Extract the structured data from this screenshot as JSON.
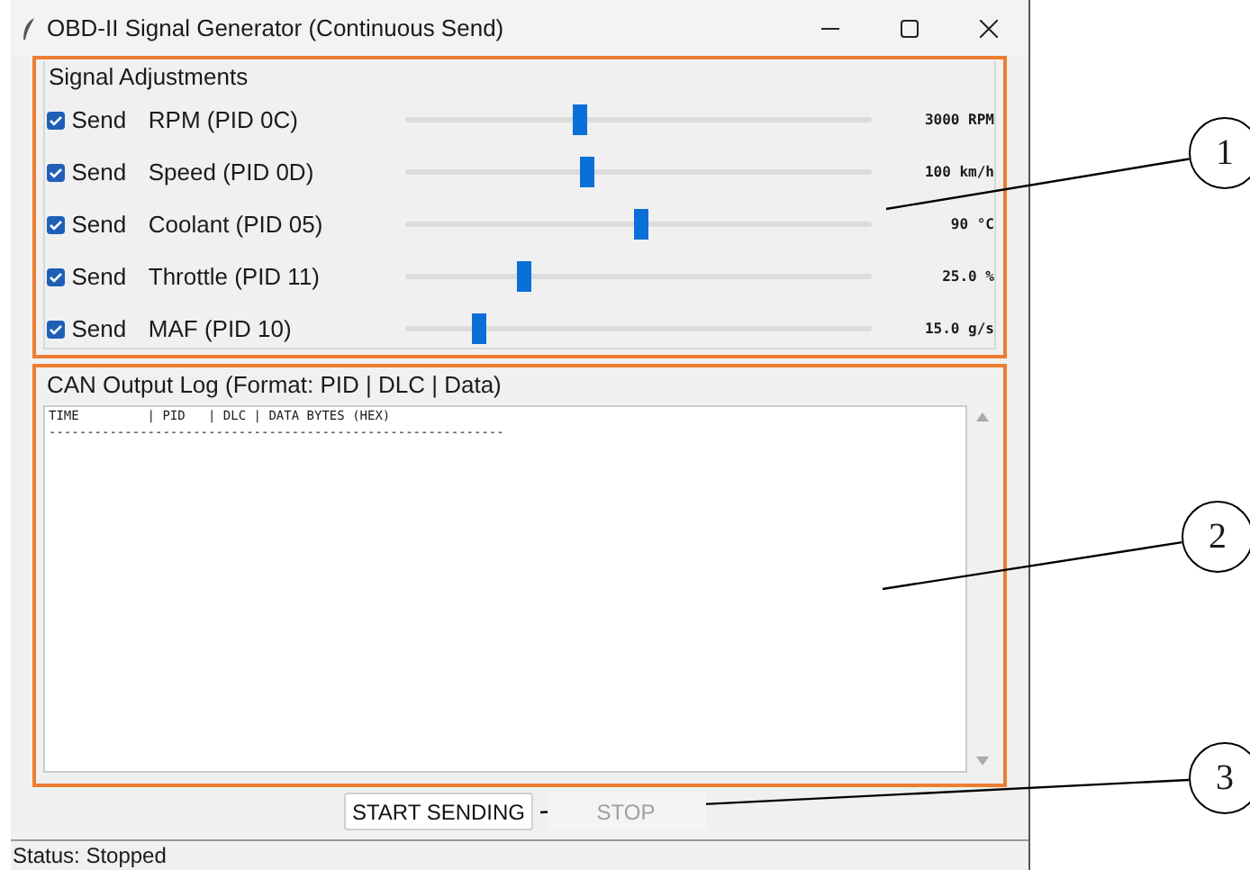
{
  "window": {
    "title": "OBD-II Signal Generator (Continuous Send)"
  },
  "signal_adjustments": {
    "title": "Signal Adjustments",
    "rows": [
      {
        "checkbox": {
          "label": "Send",
          "checked": true
        },
        "name": "RPM (PID 0C)",
        "level": 0.375,
        "reading": "3000 RPM"
      },
      {
        "checkbox": {
          "label": "Send",
          "checked": true
        },
        "name": "Speed (PID 0D)",
        "level": 0.39,
        "reading": "100 km/h"
      },
      {
        "checkbox": {
          "label": "Send",
          "checked": true
        },
        "name": "Coolant (PID 05)",
        "level": 0.505,
        "reading": "90 °C"
      },
      {
        "checkbox": {
          "label": "Send",
          "checked": true
        },
        "name": "Throttle (PID 11)",
        "level": 0.255,
        "reading": "25.0 %"
      },
      {
        "checkbox": {
          "label": "Send",
          "checked": true
        },
        "name": "MAF (PID 10)",
        "level": 0.157,
        "reading": "15.0 g/s"
      }
    ]
  },
  "log": {
    "title": "CAN Output Log (Format: PID | DLC | Data)",
    "lines": [
      "TIME         | PID   | DLC | DATA BYTES (HEX)",
      "------------------------------------------------------------"
    ]
  },
  "buttons": [
    {
      "label": "START SENDING",
      "disabled": false
    },
    {
      "label": "STOP",
      "disabled": true
    }
  ],
  "status_bar": "Status: Stopped",
  "callouts": [
    "1",
    "2",
    "3"
  ]
}
